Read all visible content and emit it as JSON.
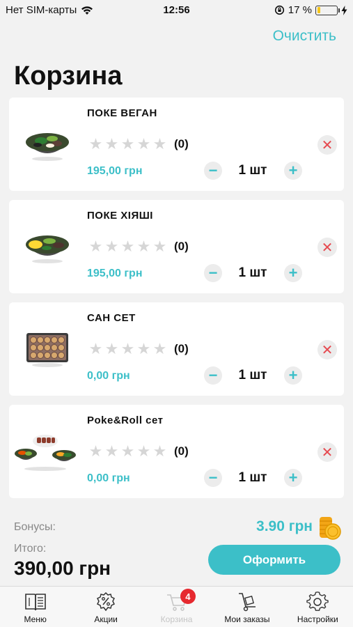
{
  "status_bar": {
    "carrier": "Нет SIM-карты",
    "time": "12:56",
    "battery_percent": "17 %",
    "battery_level": 0.17
  },
  "header": {
    "clear_label": "Очистить",
    "title": "Корзина"
  },
  "cart_items": [
    {
      "name": "ПОКЕ ВЕГАН",
      "rating_count": "(0)",
      "rating": 0,
      "price": "195,00 грн",
      "quantity": "1 шт",
      "image": "poke-bowl-icon"
    },
    {
      "name": "ПОКЕ ХІЯШІ",
      "rating_count": "(0)",
      "rating": 0,
      "price": "195,00 грн",
      "quantity": "1 шт",
      "image": "poke-bowl-icon"
    },
    {
      "name": "САН СЕТ",
      "rating_count": "(0)",
      "rating": 0,
      "price": "0,00 грн",
      "quantity": "1 шт",
      "image": "sushi-tray-icon"
    },
    {
      "name": "Poke&Roll сет",
      "rating_count": "(0)",
      "rating": 0,
      "price": "0,00 грн",
      "quantity": "1 шт",
      "image": "poke-roll-set-icon"
    }
  ],
  "summary": {
    "bonus_label": "Бонусы:",
    "bonus_value": "3.90 грн",
    "total_label": "Итого:",
    "total_value": "390,00 грн",
    "checkout_label": "Оформить"
  },
  "tab_bar": {
    "tabs": [
      {
        "label": "Меню",
        "icon": "menu-book-icon"
      },
      {
        "label": "Акции",
        "icon": "discount-icon"
      },
      {
        "label": "Корзина",
        "icon": "cart-icon",
        "badge": "4",
        "active": true
      },
      {
        "label": "Мои заказы",
        "icon": "hand-truck-icon"
      },
      {
        "label": "Настройки",
        "icon": "gear-icon"
      }
    ]
  },
  "colors": {
    "accent": "#3cbfc8",
    "remove": "#e6494f",
    "badge": "#e6292f",
    "background": "#f2f2f2"
  }
}
